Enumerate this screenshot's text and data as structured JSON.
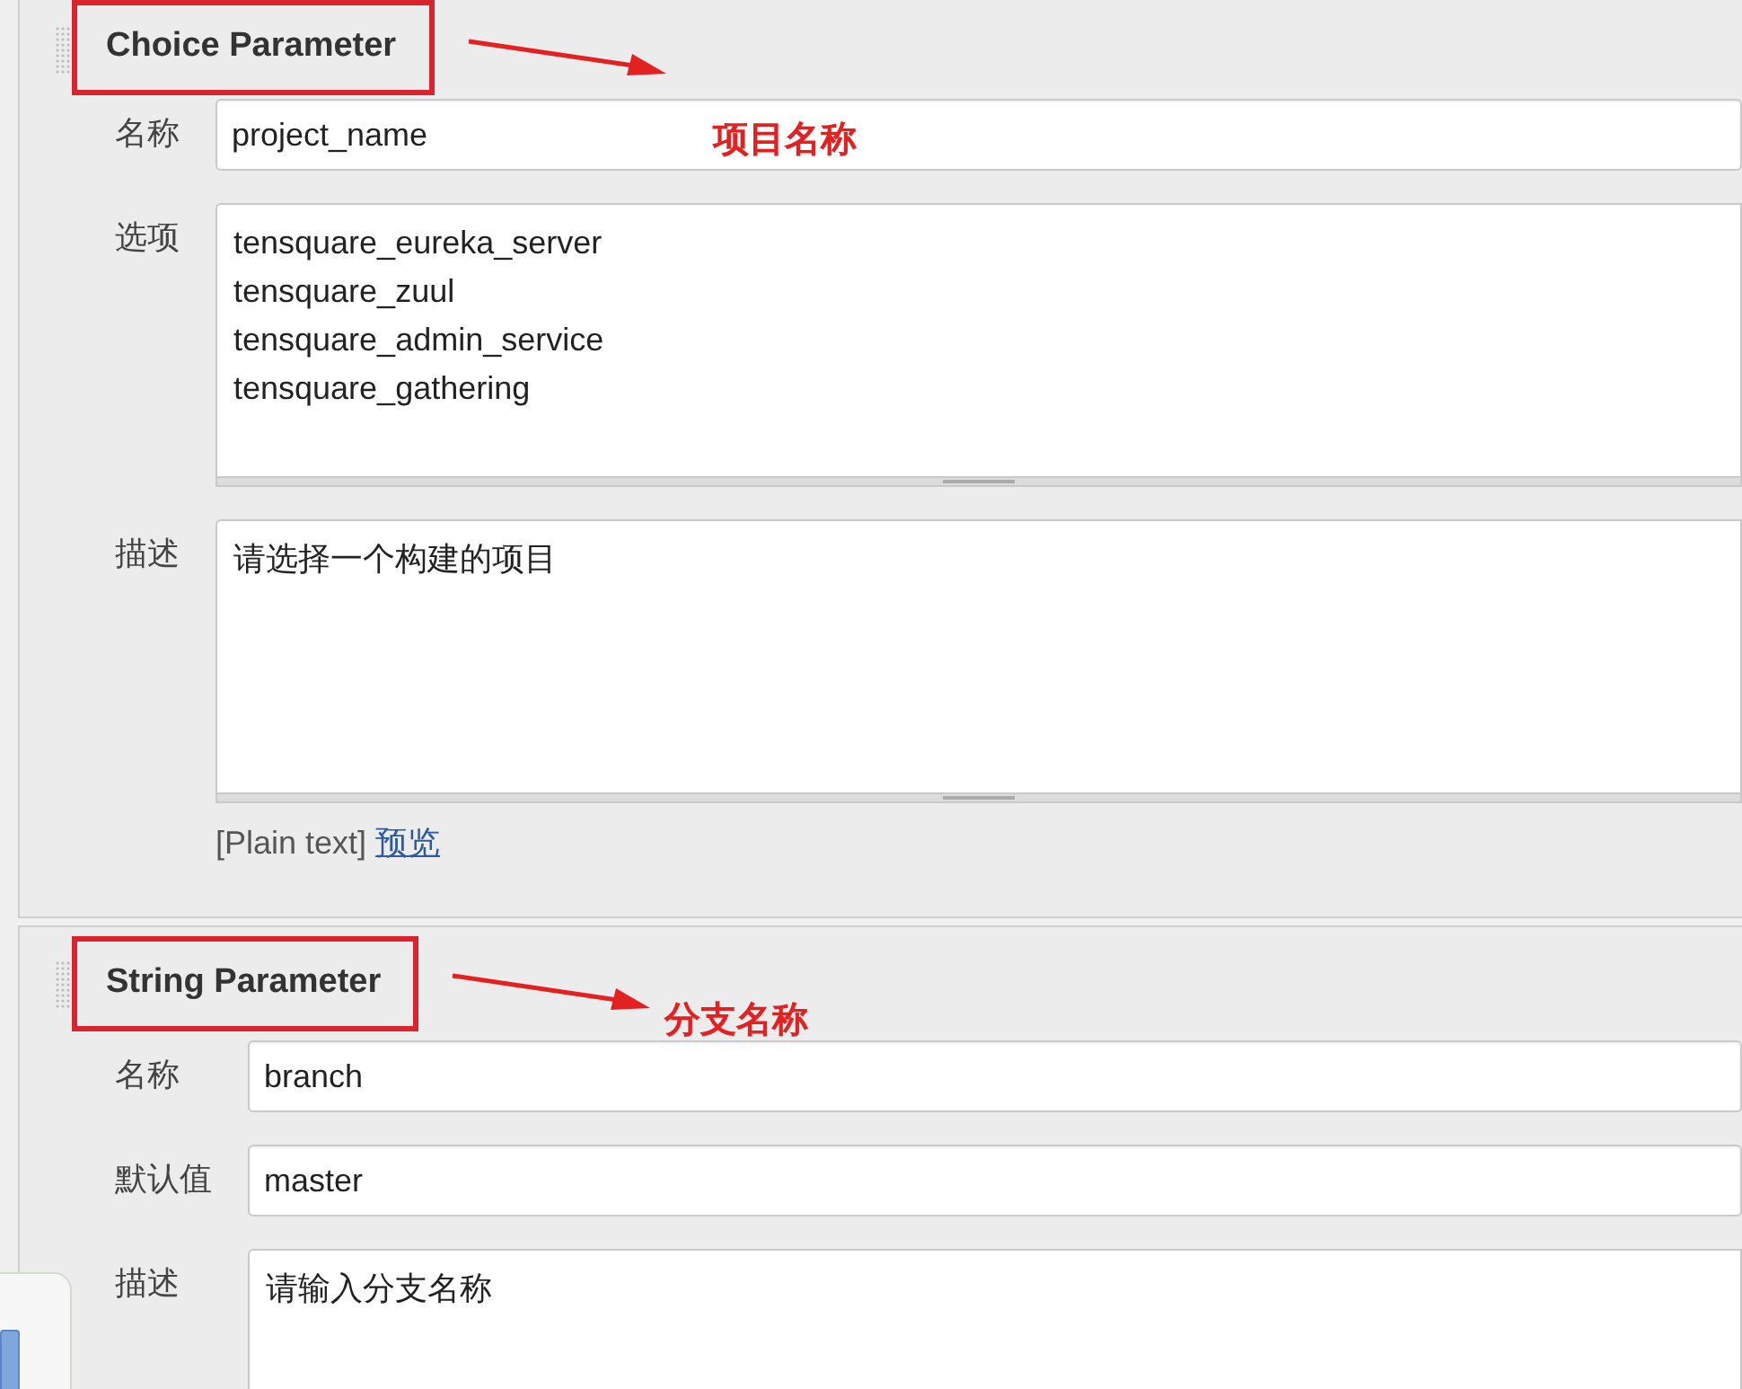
{
  "sections": [
    {
      "title": "Choice Parameter",
      "annotation": "项目名称",
      "fields": [
        {
          "kind": "input",
          "label": "名称",
          "value": "project_name"
        },
        {
          "kind": "textarea",
          "label": "选项",
          "lines": [
            "tensquare_eureka_server",
            "tensquare_zuul",
            "tensquare_admin_service",
            "tensquare_gathering"
          ]
        },
        {
          "kind": "textarea",
          "label": "描述",
          "lines": [
            "请选择一个构建的项目"
          ],
          "format": "[Plain text]",
          "preview_link": "预览"
        }
      ]
    },
    {
      "title": "String Parameter",
      "annotation": "分支名称",
      "fields": [
        {
          "kind": "input",
          "label": "名称",
          "value": "branch"
        },
        {
          "kind": "input",
          "label": "默认值",
          "value": "master"
        },
        {
          "kind": "textarea",
          "label": "描述",
          "lines": [
            "请输入分支名称"
          ]
        }
      ]
    }
  ]
}
